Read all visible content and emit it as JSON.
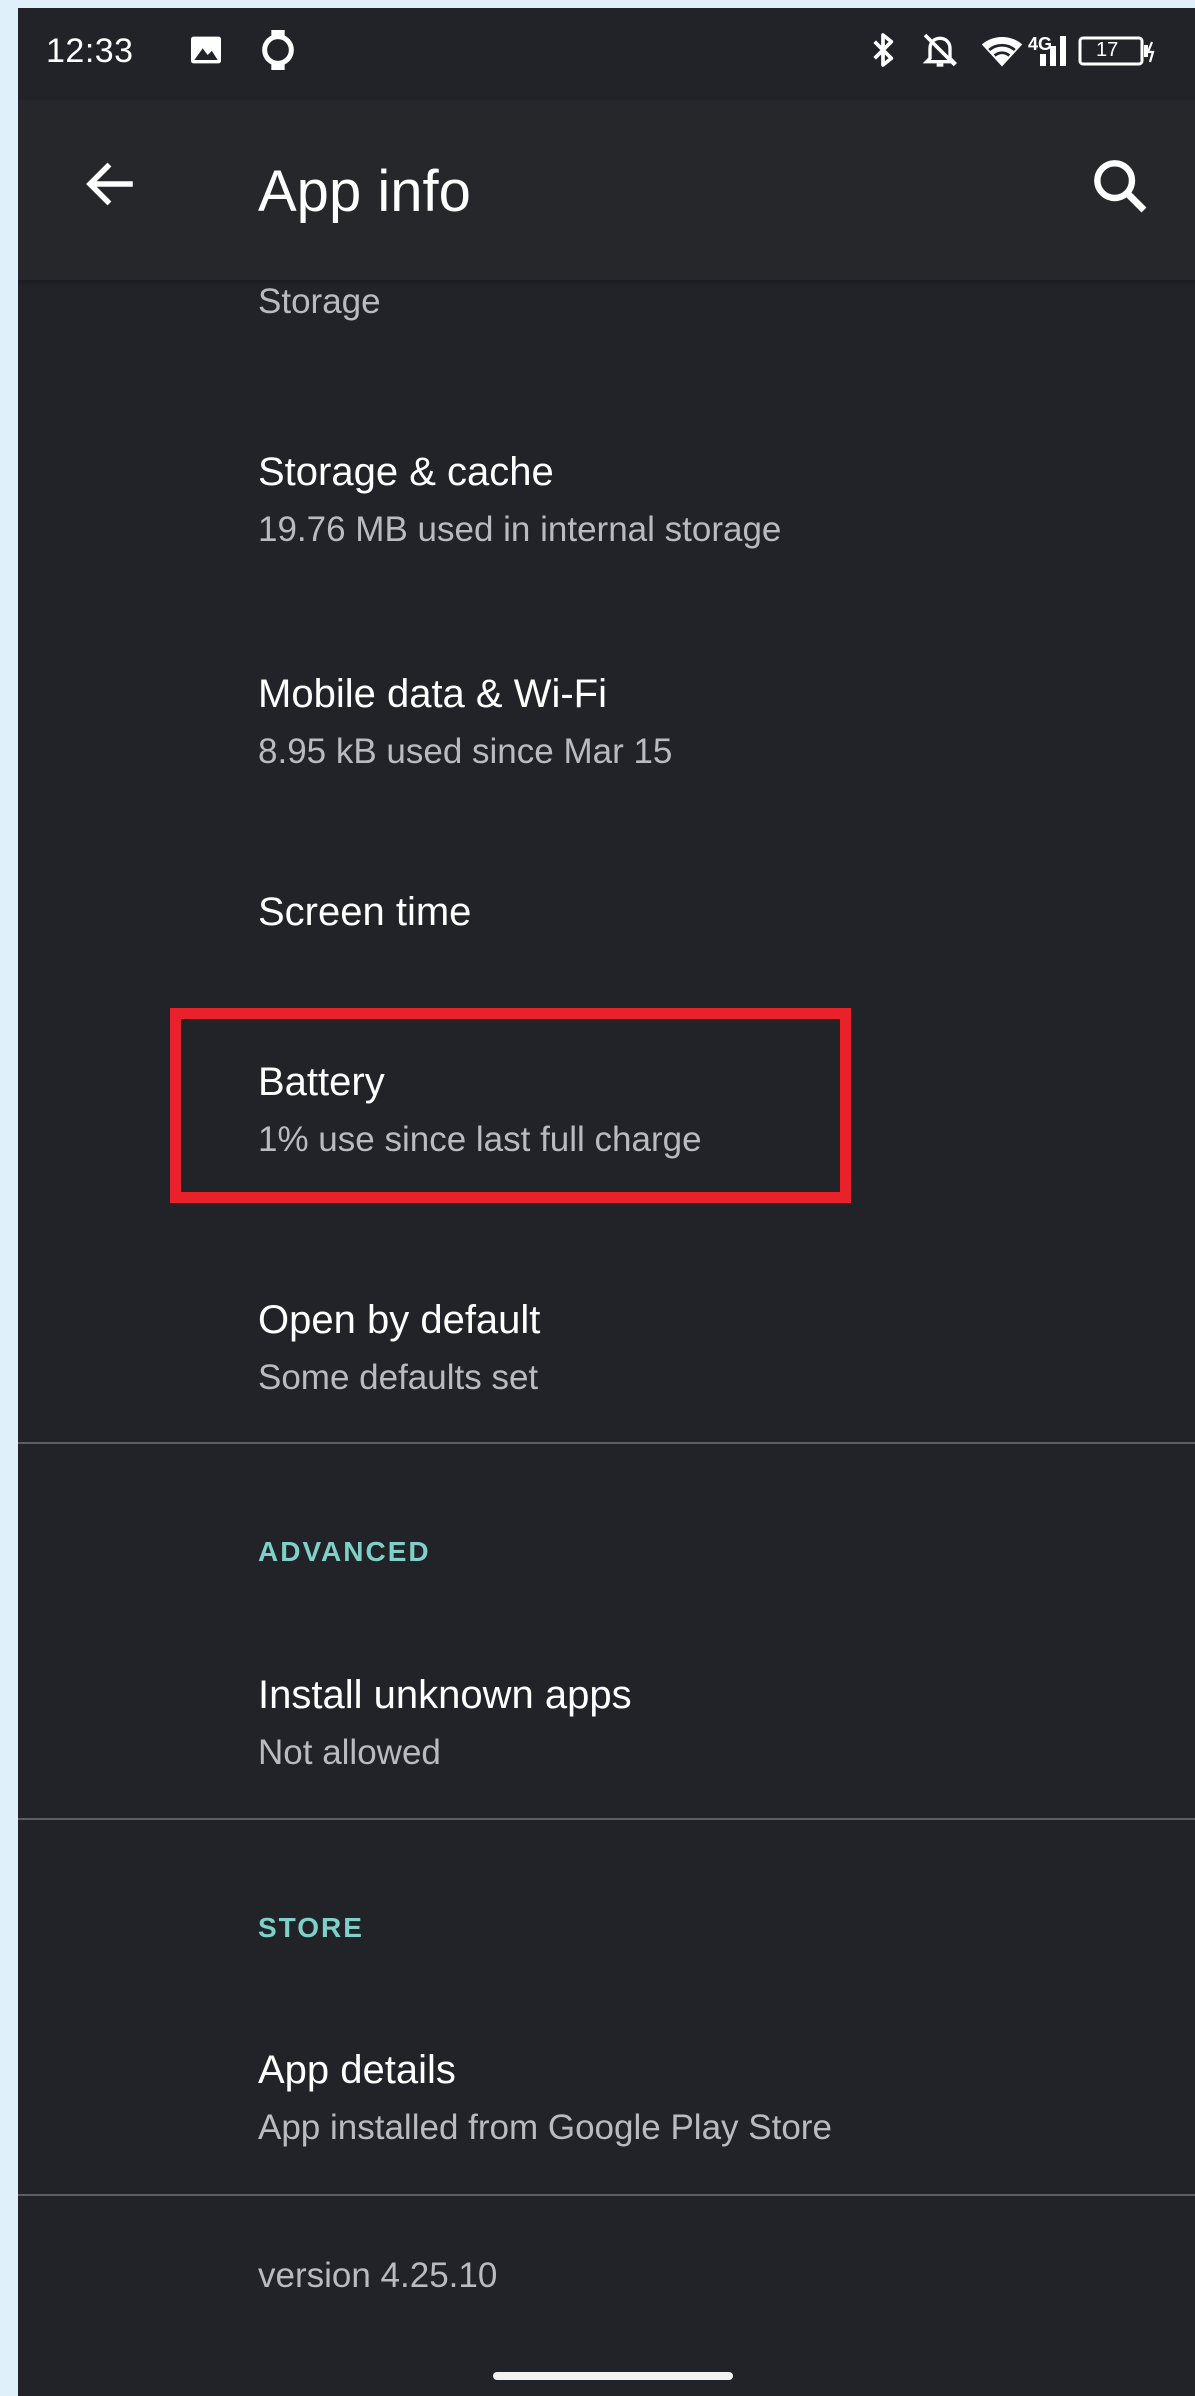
{
  "status_bar": {
    "time": "12:33",
    "network_label": "4G",
    "battery_level": "17"
  },
  "app_bar": {
    "title": "App info"
  },
  "storage_header": "Storage",
  "items": {
    "storage_cache": {
      "title": "Storage & cache",
      "subtitle": "19.76 MB used in internal storage"
    },
    "mobile_data": {
      "title": "Mobile data & Wi-Fi",
      "subtitle": "8.95 kB used since Mar 15"
    },
    "screen_time": {
      "title": "Screen time"
    },
    "battery": {
      "title": "Battery",
      "subtitle": "1% use since last full charge"
    },
    "open_by_default": {
      "title": "Open by default",
      "subtitle": "Some defaults set"
    },
    "install_unknown": {
      "title": "Install unknown apps",
      "subtitle": "Not allowed"
    },
    "app_details": {
      "title": "App details",
      "subtitle": "App installed from Google Play Store"
    }
  },
  "sections": {
    "advanced": "ADVANCED",
    "store": "STORE"
  },
  "version": "version 4.25.10",
  "colors": {
    "background": "#212328",
    "section_accent": "#7fd1c7",
    "highlight": "#e8212b"
  },
  "icons": {
    "gallery": "image-icon",
    "watch": "watch-icon",
    "bluetooth": "bluetooth-icon",
    "silent": "bell-off-icon",
    "wifi": "wifi-icon",
    "signal": "signal-icon",
    "battery": "battery-icon",
    "back": "arrow-back-icon",
    "search": "search-icon"
  }
}
